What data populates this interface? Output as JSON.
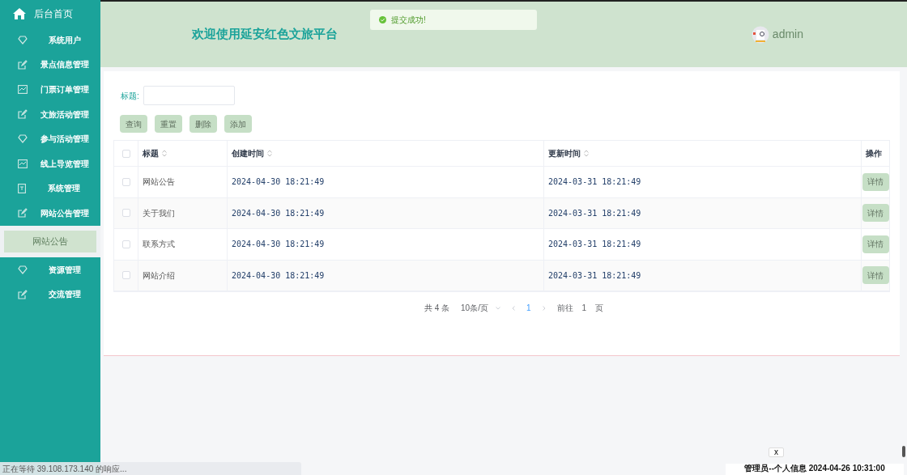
{
  "sidebar": {
    "home": "后台首页",
    "items": [
      {
        "label": "系统用户",
        "selected": false
      },
      {
        "label": "景点信息管理",
        "selected": false
      },
      {
        "label": "门票订单管理",
        "selected": false
      },
      {
        "label": "文旅活动管理",
        "selected": false
      },
      {
        "label": "参与活动管理",
        "selected": false
      },
      {
        "label": "线上导览管理",
        "selected": false
      },
      {
        "label": "系统管理",
        "selected": false
      },
      {
        "label": "网站公告管理",
        "selected": false,
        "expanded": true,
        "children": [
          {
            "label": "网站公告",
            "selected": true
          }
        ]
      },
      {
        "label": "资源管理",
        "selected": false
      },
      {
        "label": "交流管理",
        "selected": false
      }
    ]
  },
  "header": {
    "title": "欢迎使用延安红色文旅平台",
    "user": "admin"
  },
  "toast": {
    "message": "提交成功!"
  },
  "search": {
    "label": "标题:"
  },
  "buttons": [
    "查询",
    "重置",
    "删除",
    "添加"
  ],
  "table": {
    "all_checked": false,
    "columns": [
      "标题",
      "创建时间",
      "更新时间",
      "操作"
    ],
    "rows": [
      {
        "checked": false,
        "title": "网站公告",
        "created": "2024-04-30 18:21:49",
        "updated": "2024-03-31 18:21:49",
        "action": "详情"
      },
      {
        "checked": false,
        "title": "关于我们",
        "created": "2024-04-30 18:21:49",
        "updated": "2024-03-31 18:21:49",
        "action": "详情"
      },
      {
        "checked": false,
        "title": "联系方式",
        "created": "2024-04-30 18:21:49",
        "updated": "2024-03-31 18:21:49",
        "action": "详情"
      },
      {
        "checked": false,
        "title": "网站介绍",
        "created": "2024-04-30 18:21:49",
        "updated": "2024-03-31 18:21:49",
        "action": "详情"
      }
    ]
  },
  "pagination": {
    "total": "共 4 条",
    "page_size": "10条/页",
    "pages": [
      {
        "label": "1",
        "selected": true
      }
    ],
    "goto": "前往",
    "goto_value": "1",
    "page_unit": "页"
  },
  "browser_status": "正在等待 39.108.173.140 的响应...",
  "popup": {
    "close": "x",
    "text": "管理员--个人信息 2024-04-26 10:31:00"
  }
}
